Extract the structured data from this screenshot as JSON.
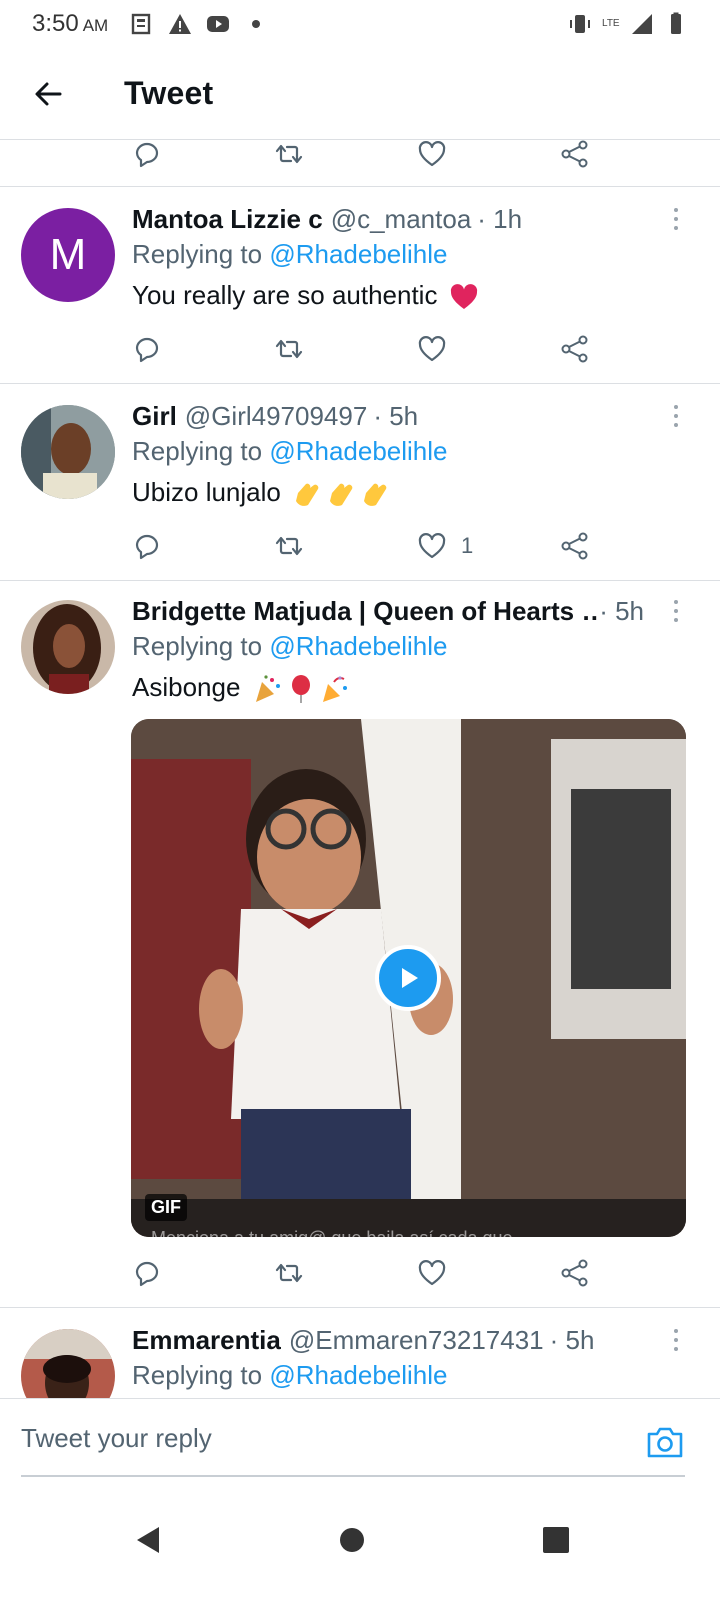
{
  "status_bar": {
    "time": "3:50",
    "ampm": "AM",
    "network": "LTE"
  },
  "header": {
    "title": "Tweet"
  },
  "tweets": [
    {
      "name": "Mantoa Lizzie c",
      "handle": "@c_mantoa",
      "time": "· 1h",
      "replying_label": "Replying to",
      "replying_handle": "@Rhadebelihle",
      "text": "You really  are so authentic",
      "avatar_letter": "M",
      "likes": ""
    },
    {
      "name": "Girl",
      "handle": "@Girl49709497",
      "time": "· 5h",
      "replying_label": "Replying to",
      "replying_handle": "@Rhadebelihle",
      "text": "Ubizo lunjalo",
      "likes": "1"
    },
    {
      "name": "Bridgette Matjuda | Queen of Hearts …",
      "handle": "",
      "time": "· 5h",
      "replying_label": "Replying to",
      "replying_handle": "@Rhadebelihle",
      "text": "Asibonge",
      "media": {
        "badge": "GIF",
        "caption": "Menciona a tu amig@ que baila así cada que"
      },
      "likes": ""
    },
    {
      "name": "Emmarentia",
      "handle": "@Emmaren73217431",
      "time": "· 5h",
      "replying_label": "Replying to",
      "replying_handle": "@Rhadebelihle"
    }
  ],
  "reply_bar": {
    "placeholder": "Tweet your reply"
  },
  "colors": {
    "accent": "#1d9bf0",
    "avatar_purple": "#7b1fa2",
    "heart_red": "#e0245e"
  },
  "icons": [
    "back-arrow-icon",
    "reply-icon",
    "retweet-icon",
    "like-icon",
    "share-icon",
    "more-icon",
    "camera-icon",
    "play-icon"
  ]
}
